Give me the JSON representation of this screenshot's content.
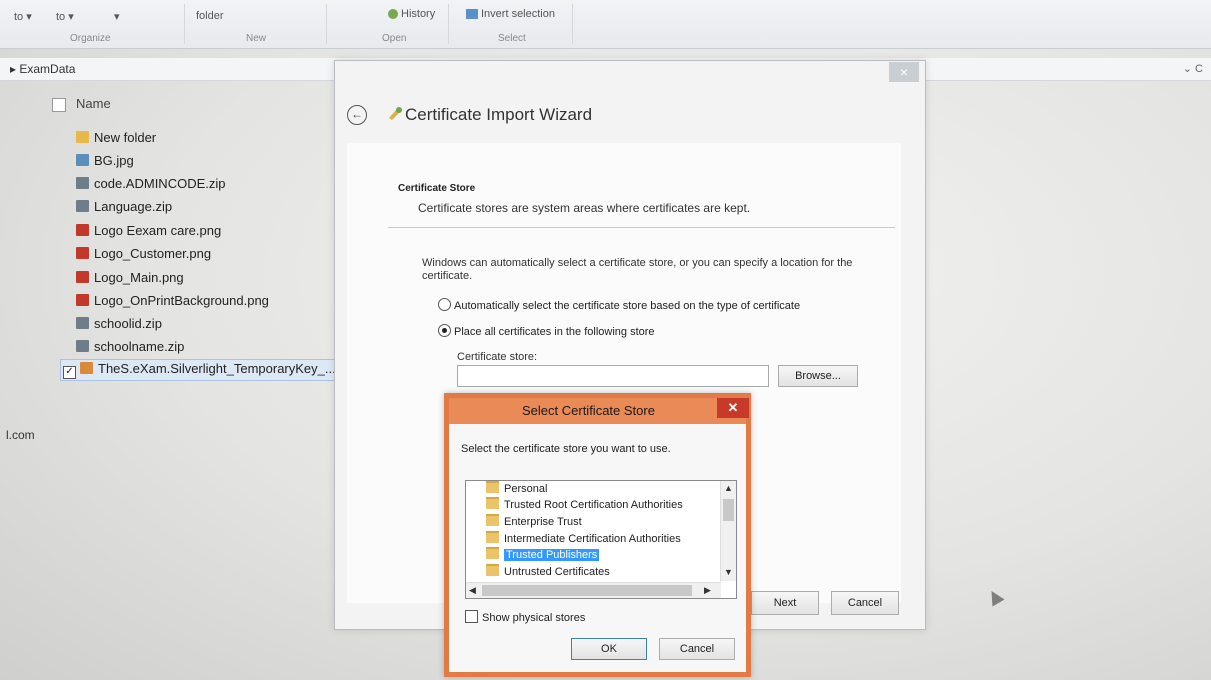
{
  "ribbon": {
    "items": [
      "to ▾",
      "to ▾",
      "▾",
      "folder",
      "History",
      "Invert selection"
    ],
    "groups": [
      "Organize",
      "New",
      "Open",
      "Select"
    ]
  },
  "address": {
    "path": "▸ ExamData",
    "right": "⌄ C"
  },
  "filelist": {
    "header": "Name",
    "files": [
      {
        "name": "New folder",
        "type": "folder"
      },
      {
        "name": "BG.jpg",
        "type": "image"
      },
      {
        "name": "code.ADMINCODE.zip",
        "type": "zip"
      },
      {
        "name": "Language.zip",
        "type": "zip"
      },
      {
        "name": "Logo Eexam care.png",
        "type": "png"
      },
      {
        "name": "Logo_Customer.png",
        "type": "png"
      },
      {
        "name": "Logo_Main.png",
        "type": "png"
      },
      {
        "name": "Logo_OnPrintBackground.png",
        "type": "png"
      },
      {
        "name": "schoolid.zip",
        "type": "zip"
      },
      {
        "name": "schoolname.zip",
        "type": "zip"
      },
      {
        "name": "TheS.eXam.Silverlight_TemporaryKey_...",
        "type": "cert"
      }
    ],
    "side_text": "l.com"
  },
  "wizard": {
    "close": "×",
    "back": "←",
    "title": "Certificate Import Wizard",
    "section_title": "Certificate Store",
    "section_desc": "Certificate stores are system areas where certificates are kept.",
    "intro": "Windows can automatically select a certificate store, or you can specify a location for the certificate.",
    "radio_auto": "Automatically select the certificate store based on the type of certificate",
    "radio_place": "Place all certificates in the following store",
    "store_label": "Certificate store:",
    "store_value": "",
    "browse": "Browse...",
    "next": "Next",
    "cancel": "Cancel"
  },
  "dialog": {
    "title": "Select Certificate Store",
    "close": "✕",
    "prompt": "Select the certificate store you want to use.",
    "stores": [
      "Personal",
      "Trusted Root Certification Authorities",
      "Enterprise Trust",
      "Intermediate Certification Authorities",
      "Trusted Publishers",
      "Untrusted Certificates"
    ],
    "selected_index": 4,
    "show_physical": "Show physical stores",
    "ok": "OK",
    "cancel": "Cancel"
  }
}
